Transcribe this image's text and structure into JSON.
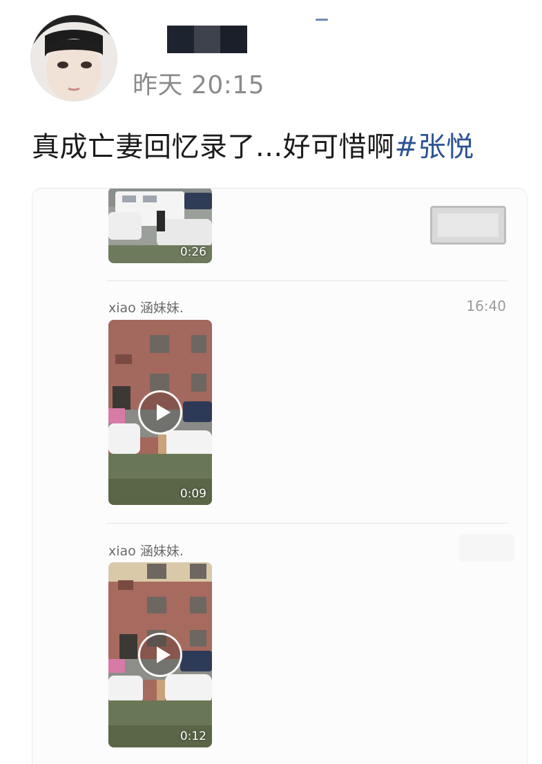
{
  "post": {
    "time": "昨天 20:15",
    "text": "真成亡妻回忆录了...好可惜啊",
    "hashtag": "#张悦"
  },
  "chat": {
    "messages": [
      {
        "sender": "",
        "time": "",
        "video_duration": "0:26"
      },
      {
        "sender": "xiao 涵妹妹.",
        "time": "16:40",
        "video_duration": "0:09"
      },
      {
        "sender": "xiao 涵妹妹.",
        "time": "",
        "video_duration": "0:12"
      }
    ]
  },
  "colors": {
    "hashtag": "#2c5394",
    "timestamp": "#8a8a8a"
  }
}
